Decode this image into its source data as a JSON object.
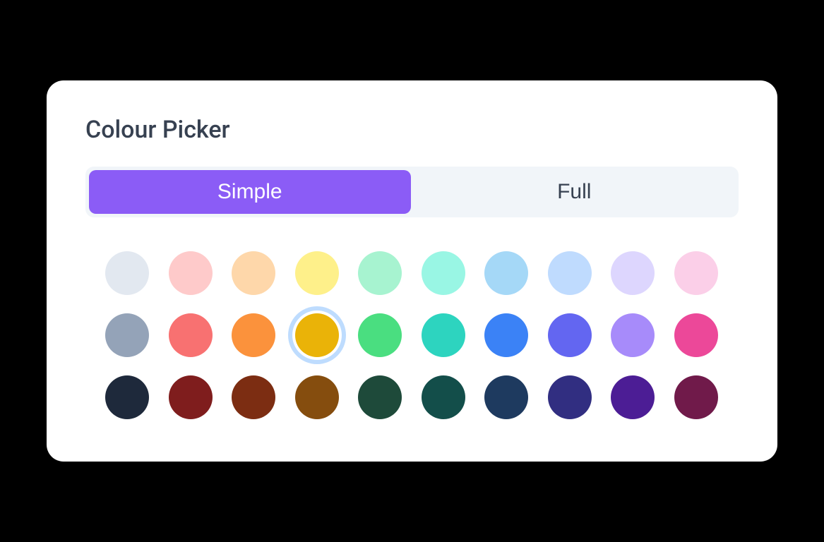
{
  "title": "Colour Picker",
  "tabs": {
    "simple": "Simple",
    "full": "Full",
    "active": "simple"
  },
  "selectedIndex": 13,
  "swatches": [
    "#e2e8f0",
    "#fecaca",
    "#fed7aa",
    "#fef08a",
    "#a7f3d0",
    "#99f6e4",
    "#a5d8f7",
    "#bfdbfe",
    "#ddd6fe",
    "#fbcfe8",
    "#94a3b8",
    "#f87171",
    "#fb923c",
    "#eab308",
    "#4ade80",
    "#2dd4bf",
    "#3b82f6",
    "#6366f1",
    "#a78bfa",
    "#ec4899",
    "#1e293b",
    "#7f1d1d",
    "#7c2d12",
    "#854d0e",
    "#1e4a3a",
    "#134e4a",
    "#1e3a5f",
    "#312e81",
    "#4c1d95",
    "#701a4a"
  ]
}
